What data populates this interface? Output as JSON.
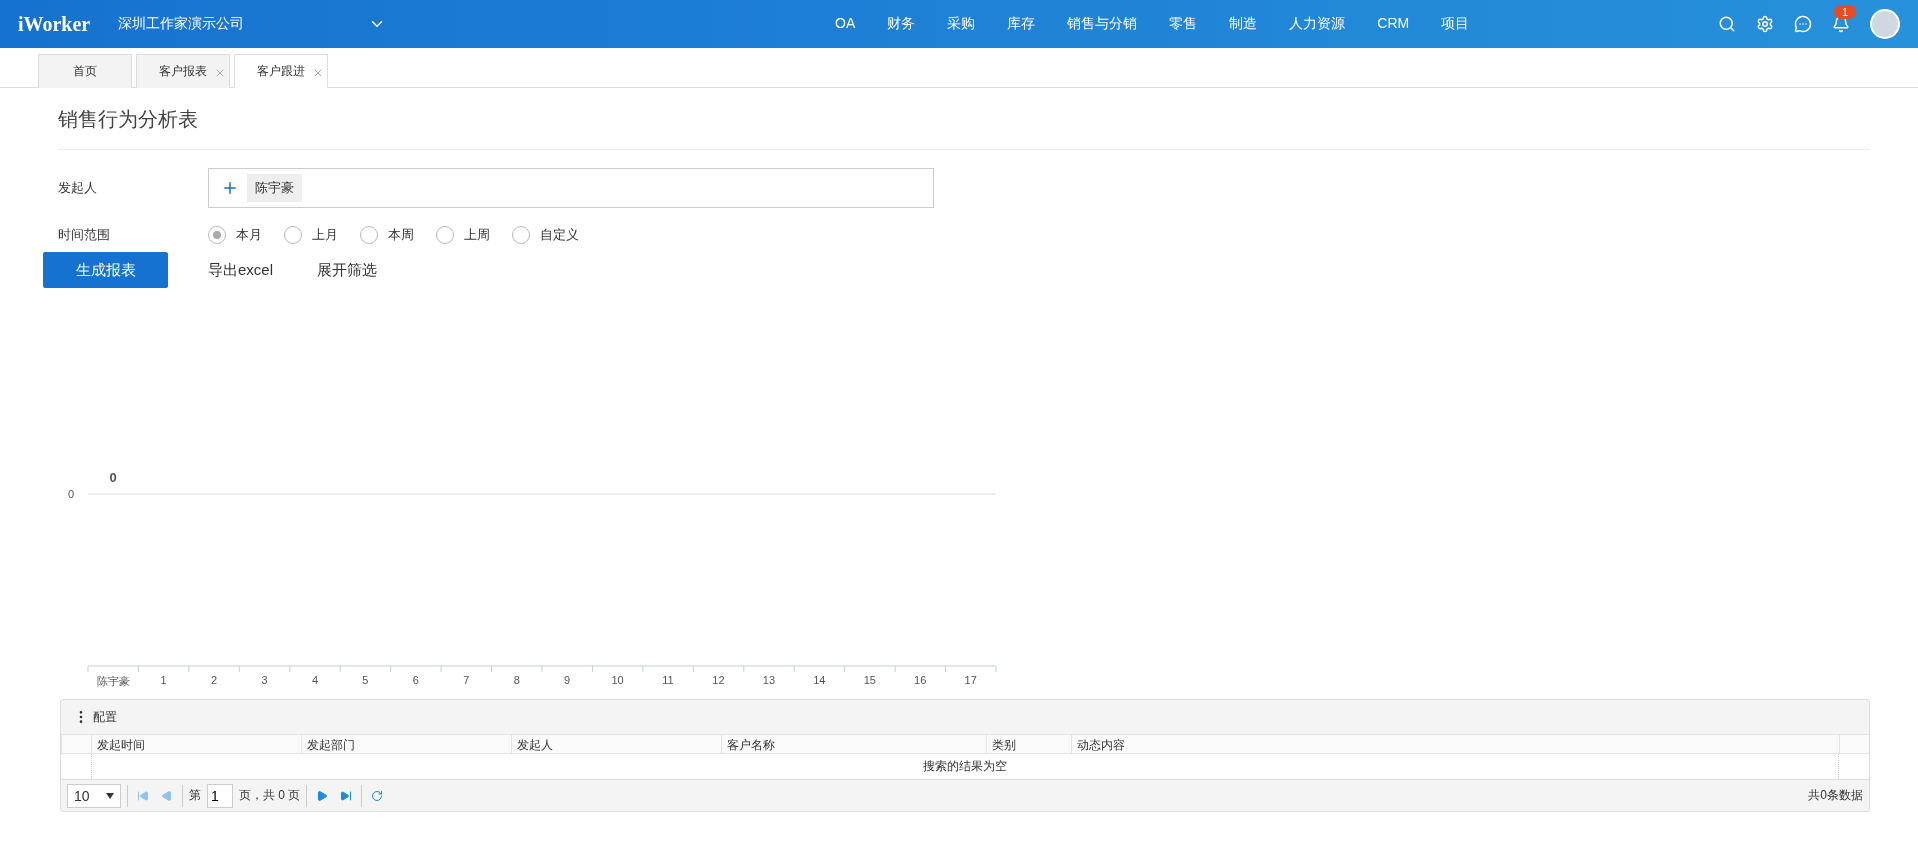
{
  "header": {
    "logo": "iWorker",
    "company": "深圳工作家演示公司",
    "nav": [
      "OA",
      "财务",
      "采购",
      "库存",
      "销售与分销",
      "零售",
      "制造",
      "人力资源",
      "CRM",
      "项目"
    ],
    "notification_count": "1"
  },
  "tabs": [
    {
      "label": "首页",
      "closable": false,
      "selected": false
    },
    {
      "label": "客户报表",
      "closable": true,
      "selected": false
    },
    {
      "label": "客户跟进",
      "closable": true,
      "selected": true
    }
  ],
  "page_title": "销售行为分析表",
  "filters": {
    "initiator_label": "发起人",
    "initiator_tags": [
      "陈宇豪"
    ],
    "time_range_label": "时间范围",
    "time_range": [
      {
        "label": "本月",
        "selected": true
      },
      {
        "label": "上月",
        "selected": false
      },
      {
        "label": "本周",
        "selected": false
      },
      {
        "label": "上周",
        "selected": false
      },
      {
        "label": "自定义",
        "selected": false
      }
    ]
  },
  "actions": [
    {
      "label": "生成报表",
      "kind": "primary"
    },
    {
      "label": "导出excel",
      "kind": "link"
    },
    {
      "label": "展开筛选",
      "kind": "link"
    }
  ],
  "chart": {
    "y_axis_label": "0",
    "value_label": "0",
    "x_labels": [
      "陈宇豪",
      "1",
      "2",
      "3",
      "4",
      "5",
      "6",
      "7",
      "8",
      "9",
      "10",
      "11",
      "12",
      "13",
      "14",
      "15",
      "16",
      "17"
    ]
  },
  "table": {
    "toolbar_label": "配置",
    "columns": [
      "发起时间",
      "发起部门",
      "发起人",
      "客户名称",
      "类别",
      "动态内容"
    ],
    "empty_text": "搜索的结果为空",
    "pager": {
      "page_size": "10",
      "page_prefix": "第",
      "page": "1",
      "page_suffix": "页，共 0 页",
      "total": "共0条数据"
    }
  }
}
